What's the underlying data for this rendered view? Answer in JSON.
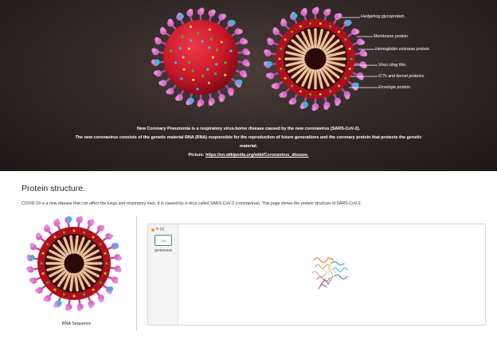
{
  "hero": {
    "labels": [
      "Hedgehog glycoprotein.",
      "Membrane protein.",
      "Hemoglobin esterase protein.",
      "Virus cling film.",
      "ICTs and kernel proteins.",
      "Envelope protein."
    ],
    "caption_line1": "New Coronary Pneumonia is a respiratory virus-borne disease caused by the new coronavirus (SARS-CoV-2).",
    "caption_line2": "The new coronavirus consists of the genetic material RNA (RNA) responsible for the reproduction of future generations and the coronary protein that protects the genetic",
    "caption_line3": "material.",
    "picture_prefix": "Picture: ",
    "picture_link": "https://en.wikipedia.org/wiki/Coronavirus_disease."
  },
  "protein": {
    "title": "Protein structure.",
    "description": "COVID-19 is a new disease that can affect the lungs and respiratory tract. It is caused by a virus called SARS-CoV-2 (coronavirus). This page shows the protein structure of SARS-CoV-2.",
    "image_caption": "RNA Sequence",
    "viewer": {
      "chain_label": "S (1)",
      "thumb_text": "7jxt",
      "thumb_id": "QHD43416"
    }
  },
  "colors": {
    "virus_body": "#c8182a",
    "spike": "#d96ac8",
    "protein_cyan": "#38b8e6",
    "dot_green": "#4caf2a",
    "dot_yellow": "#e6c43a",
    "rna_coil": "#f2d9b0",
    "chain_marker": "#f39c12"
  }
}
